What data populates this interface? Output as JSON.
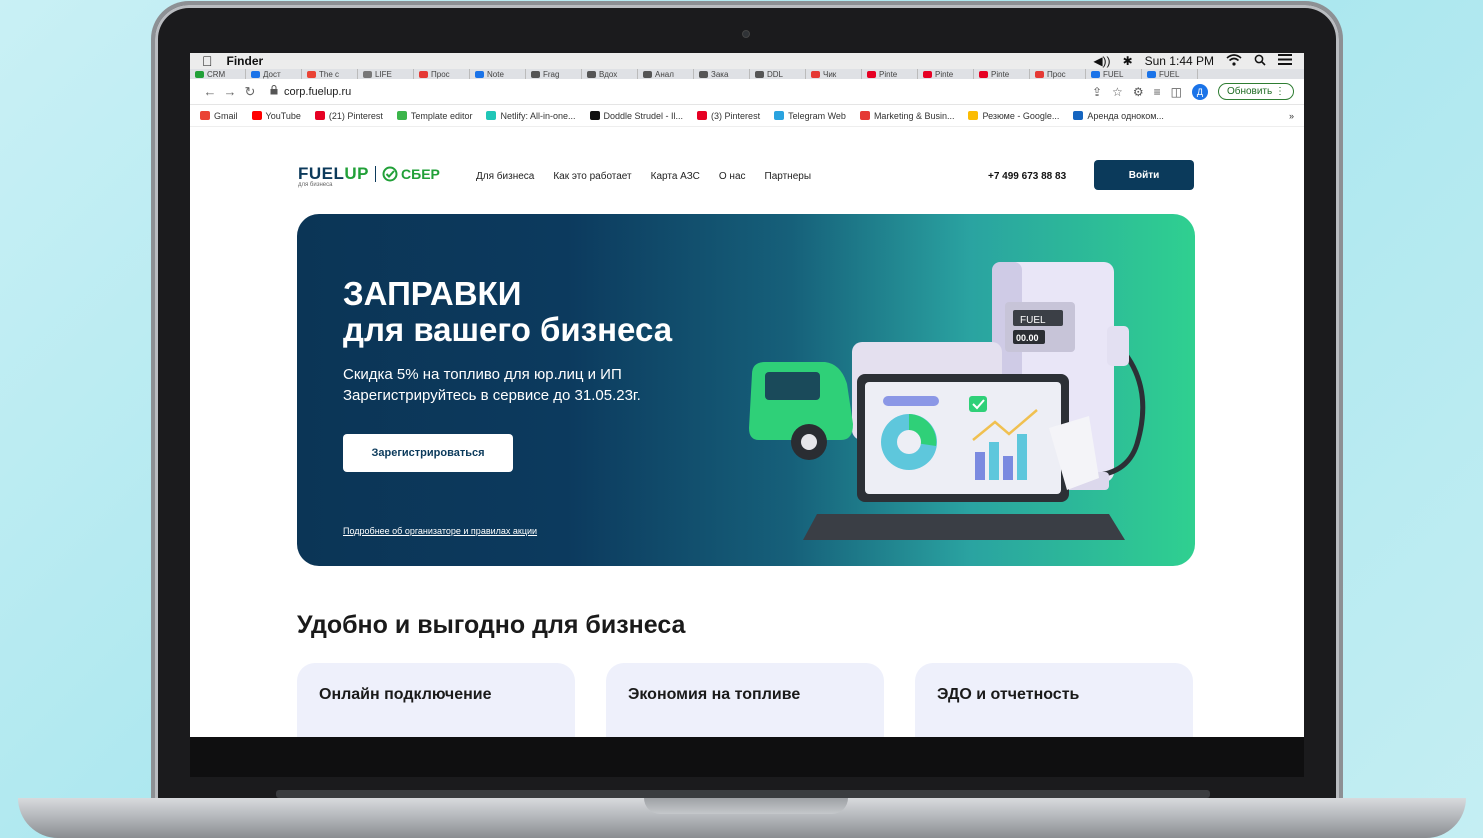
{
  "menubar": {
    "apple": "",
    "app_name": "Finder",
    "volume": "◀))",
    "bluetooth": "✱",
    "clock": "Sun 1:44 PM"
  },
  "tabs": [
    "CRM",
    "Дост",
    "The c",
    "LIFE",
    "Прос",
    "Note",
    "Frag",
    "Вдох",
    "Анал",
    "Зака",
    "DDL",
    "Чик",
    "Pinte",
    "Pinte",
    "Pinte",
    "Прос",
    "FUEL",
    "FUEL"
  ],
  "browser": {
    "url": "corp.fuelup.ru",
    "avatar_letter": "Д",
    "update_label": "Обновить"
  },
  "bookmarks": [
    {
      "label": "Gmail",
      "color": "#ea4335"
    },
    {
      "label": "YouTube",
      "color": "#ff0000"
    },
    {
      "label": "(21) Pinterest",
      "color": "#e60023"
    },
    {
      "label": "Template editor",
      "color": "#3bb54a"
    },
    {
      "label": "Netlify: All-in-one...",
      "color": "#20c6b7"
    },
    {
      "label": "Doddle Strudel - Il...",
      "color": "#111111"
    },
    {
      "label": "(3) Pinterest",
      "color": "#e60023"
    },
    {
      "label": "Telegram Web",
      "color": "#2aa3df"
    },
    {
      "label": "Marketing & Busin...",
      "color": "#e53935"
    },
    {
      "label": "Резюме - Google...",
      "color": "#fbbc04"
    },
    {
      "label": "Аренда одноком...",
      "color": "#1565c0"
    }
  ],
  "bookmarks_more": "»",
  "site": {
    "logo_fuel": "FUEL",
    "logo_up": "UP",
    "logo_sber": "СБЕР",
    "logo_sub": "для бизнеса",
    "nav": [
      "Для бизнеса",
      "Как это работает",
      "Карта АЗС",
      "О нас",
      "Партнеры"
    ],
    "phone": "+7 499 673 88 83",
    "login": "Войти"
  },
  "hero": {
    "title_line1": "ЗАПРАВКИ",
    "title_line2": "для вашего бизнеса",
    "sub_line1": "Скидка 5% на топливо для юр.лиц и ИП",
    "sub_line2": "Зарегистрируйтесь в сервисе до 31.05.23г.",
    "register": "Зарегистрироваться",
    "link": "Подробнее об организаторе и правилах акции",
    "pump_label": "FUEL",
    "pump_value": "00.00"
  },
  "section": {
    "title": "Удобно и выгодно для бизнеса",
    "cards": [
      "Онлайн подключение",
      "Экономия на топливе",
      "ЭДО и отчетность"
    ]
  },
  "colors": {
    "brand_dark": "#0b3a5b",
    "brand_green": "#21a038",
    "card_bg": "#eef0fb"
  }
}
